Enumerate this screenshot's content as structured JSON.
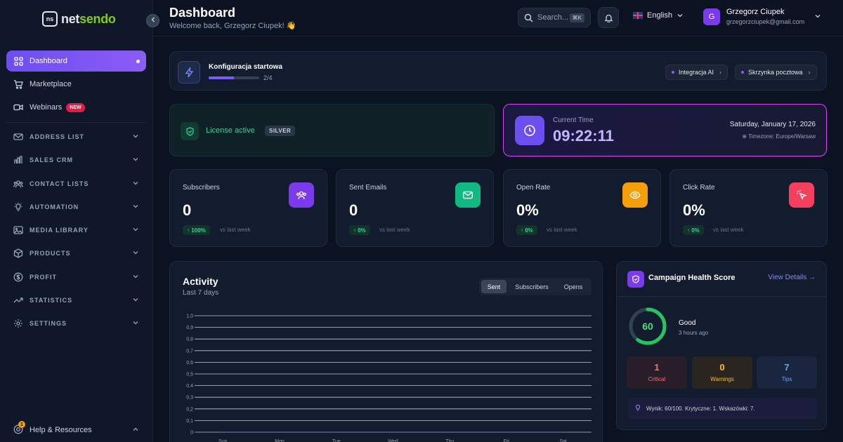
{
  "brand": {
    "logo_mark": "ns",
    "name_part1": "net",
    "name_part2": "sendo"
  },
  "sidebar": {
    "items": [
      {
        "label": "Dashboard",
        "icon": "grid-icon"
      },
      {
        "label": "Marketplace",
        "icon": "cart-icon"
      },
      {
        "label": "Webinars",
        "icon": "video-icon",
        "badge": "NEW"
      }
    ],
    "groups": [
      {
        "label": "ADDRESS LIST",
        "icon": "mail-icon"
      },
      {
        "label": "SALES CRM",
        "icon": "bar-chart-icon"
      },
      {
        "label": "CONTACT LISTS",
        "icon": "users-icon"
      },
      {
        "label": "AUTOMATION",
        "icon": "bulb-icon"
      },
      {
        "label": "MEDIA LIBRARY",
        "icon": "image-icon"
      },
      {
        "label": "PRODUCTS",
        "icon": "box-icon"
      },
      {
        "label": "PROFIT",
        "icon": "dollar-icon"
      },
      {
        "label": "STATISTICS",
        "icon": "trend-icon"
      },
      {
        "label": "SETTINGS",
        "icon": "gear-icon"
      }
    ],
    "help": {
      "label": "Help & Resources",
      "notification_count": "1"
    }
  },
  "header": {
    "title": "Dashboard",
    "subtitle": "Welcome back, Grzegorz Ciupek! 👋",
    "search_placeholder": "Search...",
    "search_shortcut": "⌘K",
    "language": "English",
    "user_initial": "G",
    "user_name": "Grzegorz Ciupek",
    "user_email": "grzegorzciupek@gmail.com"
  },
  "setup": {
    "title": "Konfiguracja startowa",
    "progress_text": "2/4",
    "progress_fraction": 0.5,
    "pills": [
      "Integracja AI",
      "Skrzynka pocztowa"
    ]
  },
  "license": {
    "text": "License active",
    "tier": "SILVER"
  },
  "clock": {
    "label": "Current Time",
    "time": "09:22:11",
    "date": "Saturday, January 17, 2026",
    "timezone": "Timezone: Europe/Warsaw"
  },
  "stats": [
    {
      "label": "Subscribers",
      "value": "0",
      "change": "↑ 100%",
      "vs": "vs last week",
      "icon": "users-icon",
      "color": "#7c3aed"
    },
    {
      "label": "Sent Emails",
      "value": "0",
      "change": "↑ 0%",
      "vs": "vs last week",
      "icon": "mail-icon",
      "color": "#10b981"
    },
    {
      "label": "Open Rate",
      "value": "0%",
      "change": "↑ 0%",
      "vs": "vs last week",
      "icon": "eye-icon",
      "color": "#f59e0b"
    },
    {
      "label": "Click Rate",
      "value": "0%",
      "change": "↑ 0%",
      "vs": "vs last week",
      "icon": "cursor-click-icon",
      "color": "#f43f5e"
    }
  ],
  "activity": {
    "title": "Activity",
    "subtitle": "Last 7 days",
    "tabs": [
      "Sent",
      "Subscribers",
      "Opens"
    ],
    "active_tab": "Sent"
  },
  "chart_data": {
    "type": "line",
    "categories": [
      "Sun",
      "Mon",
      "Tue",
      "Wed",
      "Thu",
      "Fri",
      "Sat"
    ],
    "yticks": [
      "1,0",
      "0,9",
      "0,8",
      "0,7",
      "0,6",
      "0,5",
      "0,4",
      "0,3",
      "0,2",
      "0,1",
      "0"
    ],
    "ylim": [
      0,
      1
    ],
    "grid": true,
    "series": [
      {
        "values": [
          0,
          0,
          0,
          0,
          0,
          0,
          0
        ]
      }
    ]
  },
  "health": {
    "title": "Campaign Health Score",
    "link": "View Details →",
    "score": "60",
    "score_fraction": 0.6,
    "status": "Good",
    "updated": "3 hours ago",
    "boxes": [
      {
        "value": "1",
        "label": "Critical",
        "color": "#f87171",
        "bg": "#2a1d2a"
      },
      {
        "value": "0",
        "label": "Warnings",
        "color": "#fbbf24",
        "bg": "#2a2520"
      },
      {
        "value": "7",
        "label": "Tips",
        "color": "#60a5fa",
        "bg": "#1a2540"
      }
    ],
    "summary": "Wynik: 60/100. Krytyczne: 1. Wskazówki: 7."
  }
}
